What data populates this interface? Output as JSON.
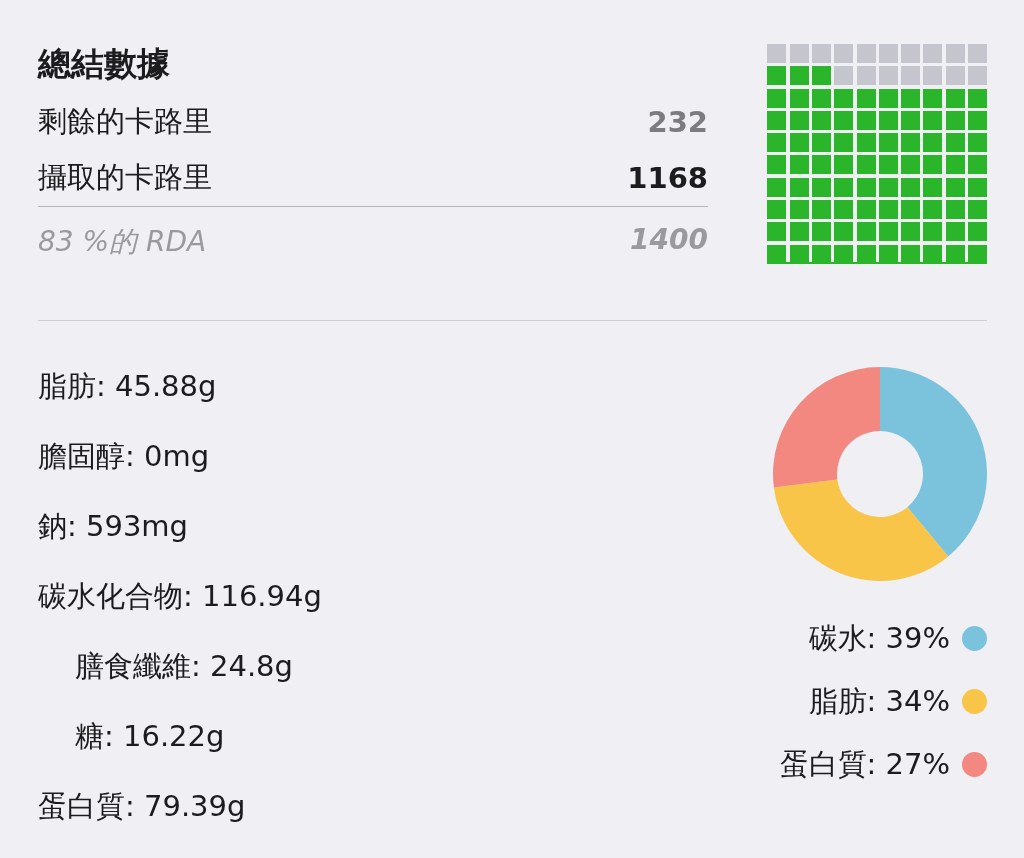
{
  "summary": {
    "title": "總結數據",
    "rows": [
      {
        "label": "剩餘的卡路里",
        "value": "232",
        "kind": "remaining"
      },
      {
        "label": "攝取的卡路里",
        "value": "1168",
        "kind": "consumed"
      }
    ],
    "rda": {
      "label": "83 %的 RDA",
      "value": "1400"
    },
    "waffle": {
      "level": 0.83
    }
  },
  "nutrients": [
    {
      "label": "脂肪: 45.88g"
    },
    {
      "label": "膽固醇: 0mg"
    },
    {
      "label": "鈉: 593mg"
    },
    {
      "label": "碳水化合物: 116.94g",
      "children": [
        {
          "label": "膳食纖維: 24.8g"
        },
        {
          "label": "糖: 16.22g"
        }
      ]
    },
    {
      "label": "蛋白質: 79.39g"
    }
  ],
  "macros": {
    "chart_data": {
      "type": "donut",
      "values": [
        39,
        34,
        27
      ]
    },
    "legend": [
      {
        "label": "碳水: 39%",
        "color": "#7bc3dc"
      },
      {
        "label": "脂肪: 34%",
        "color": "#f8c548"
      },
      {
        "label": "蛋白質: 27%",
        "color": "#f28880"
      }
    ]
  }
}
